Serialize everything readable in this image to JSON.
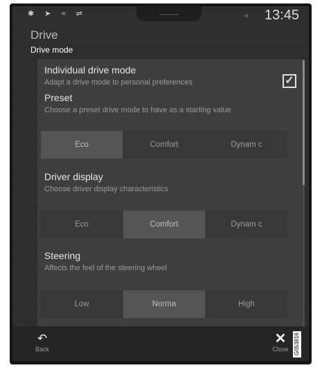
{
  "status_bar": {
    "icons": [
      "bluetooth-icon",
      "navigation-icon",
      "wifi-icon",
      "usb-icon"
    ],
    "icon_glyphs": "✱ ➤ ≈ ⇌",
    "volume_icon": "·‹",
    "time": "13:45"
  },
  "header": {
    "title": "Drive",
    "subtitle": "Drive mode"
  },
  "settings": {
    "individual": {
      "title": "Individual drive mode",
      "description": "Adapt a drive mode to personal preferences",
      "checked": true,
      "check_glyph": "✓"
    },
    "preset": {
      "title": "Preset",
      "description": "Choose a preset drive mode to have as a starting value",
      "options": [
        "Eco",
        "Comfort",
        "Dynam c"
      ],
      "selected": "Eco"
    },
    "driver_display": {
      "title": "Driver display",
      "description": "Choose driver display characteristics",
      "options": [
        "Eco",
        "Comfort",
        "Dynam c"
      ],
      "selected": "Comfort"
    },
    "steering": {
      "title": "Steering",
      "description": "Affects the feel of the steering wheel",
      "options": [
        "Low",
        "Norma",
        "High"
      ],
      "selected": "Norma"
    }
  },
  "bottom_bar": {
    "back_label": "Back",
    "back_glyph": "↶",
    "close_label": "Close",
    "close_glyph": "✕"
  },
  "figure_code": "G053816",
  "colors": {
    "screen_bg": "#2d2d2d",
    "panel_bg": "#3e3e3e",
    "selected_bg": "#555555"
  }
}
